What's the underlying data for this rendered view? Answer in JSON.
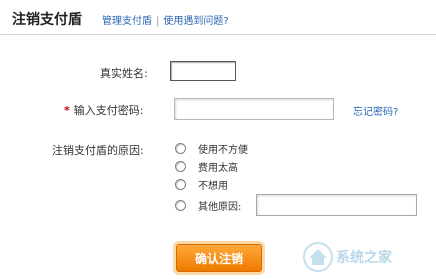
{
  "header": {
    "title": "注销支付盾",
    "link_manage": "管理支付盾",
    "separator": "|",
    "link_help": "使用遇到问题?"
  },
  "form": {
    "name_label": "真实姓名:",
    "password_required_mark": "*",
    "password_label": "输入支付密码:",
    "forgot_link": "忘记密码?",
    "reason_label": "注销支付盾的原因:",
    "reasons": [
      {
        "label": "使用不方便"
      },
      {
        "label": "费用太高"
      },
      {
        "label": "不想用"
      },
      {
        "label": "其他原因:"
      }
    ],
    "confirm_button": "确认注销"
  },
  "watermark": {
    "text": "系统之家"
  },
  "colors": {
    "link": "#2a66b5",
    "required": "#cc0000",
    "button": "#f08a10",
    "button_text": "#ffffff"
  }
}
